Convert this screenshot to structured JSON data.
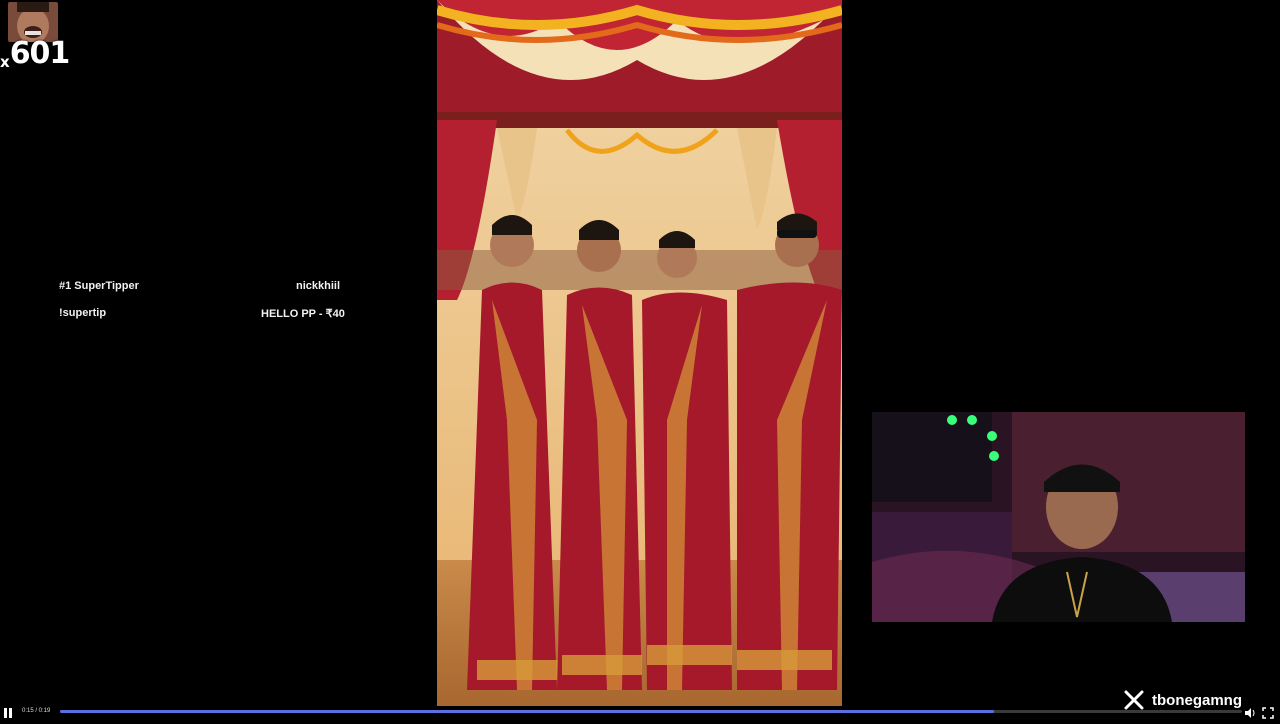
{
  "overlay": {
    "counter_prefix": "x",
    "counter_value": "601"
  },
  "supertip": {
    "row1_left": "#1 SuperTipper",
    "row1_right": "nickkhiil",
    "row2_left": "!supertip",
    "row2_right": "HELLO PP - ₹40"
  },
  "branding": {
    "x_icon": "x-logo-icon",
    "handle": "tbonegamng"
  },
  "player": {
    "state": "paused",
    "time": "0:15 / 0:19",
    "progress": 0.79,
    "colors": {
      "progress": "#5a70e0"
    }
  }
}
